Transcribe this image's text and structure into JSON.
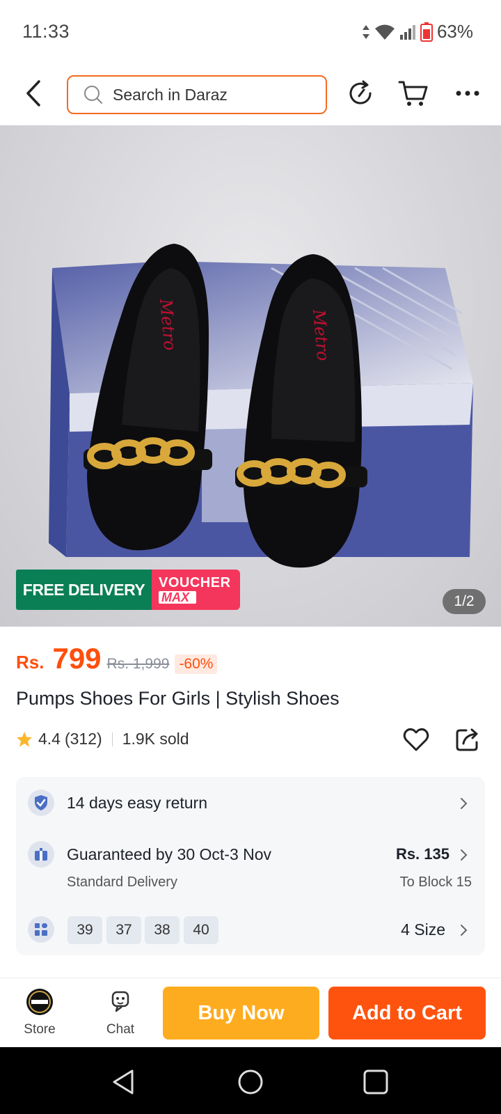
{
  "status_bar": {
    "time": "11:33",
    "battery": "63%"
  },
  "topbar": {
    "search_placeholder": "Search in Daraz",
    "icons": [
      "back-arrow-icon",
      "search-icon",
      "history-icon",
      "cart-icon",
      "more-icon"
    ]
  },
  "gallery": {
    "free_delivery": "FREE DELIVERY",
    "voucher_line1": "VOUCHER",
    "voucher_line2": "MAX",
    "counter": "1/2",
    "brand_mark": "Metro"
  },
  "product": {
    "currency": "Rs.",
    "price": "799",
    "old_price": "Rs. 1,999",
    "discount": "-60%",
    "title": "Pumps Shoes For Girls | Stylish Shoes",
    "rating": "4.4",
    "reviews": "(312)",
    "sold": "1.9K sold"
  },
  "info": {
    "returns": "14 days easy return",
    "delivery_title": "Guaranteed by 30 Oct-3 Nov",
    "delivery_type": "Standard Delivery",
    "delivery_price": "Rs. 135",
    "delivery_to": "To Block 15",
    "sizes": [
      "39",
      "37",
      "38",
      "40"
    ],
    "size_count": "4 Size"
  },
  "bottom_bar": {
    "store_label": "Store",
    "chat_label": "Chat",
    "buy_now": "Buy Now",
    "add_to_cart": "Add to Cart"
  },
  "colors": {
    "accent_orange": "#fe530f",
    "buy_yellow": "#feac1f",
    "free_delivery_green": "#0a7f55",
    "voucher_pink": "#f5365c"
  }
}
